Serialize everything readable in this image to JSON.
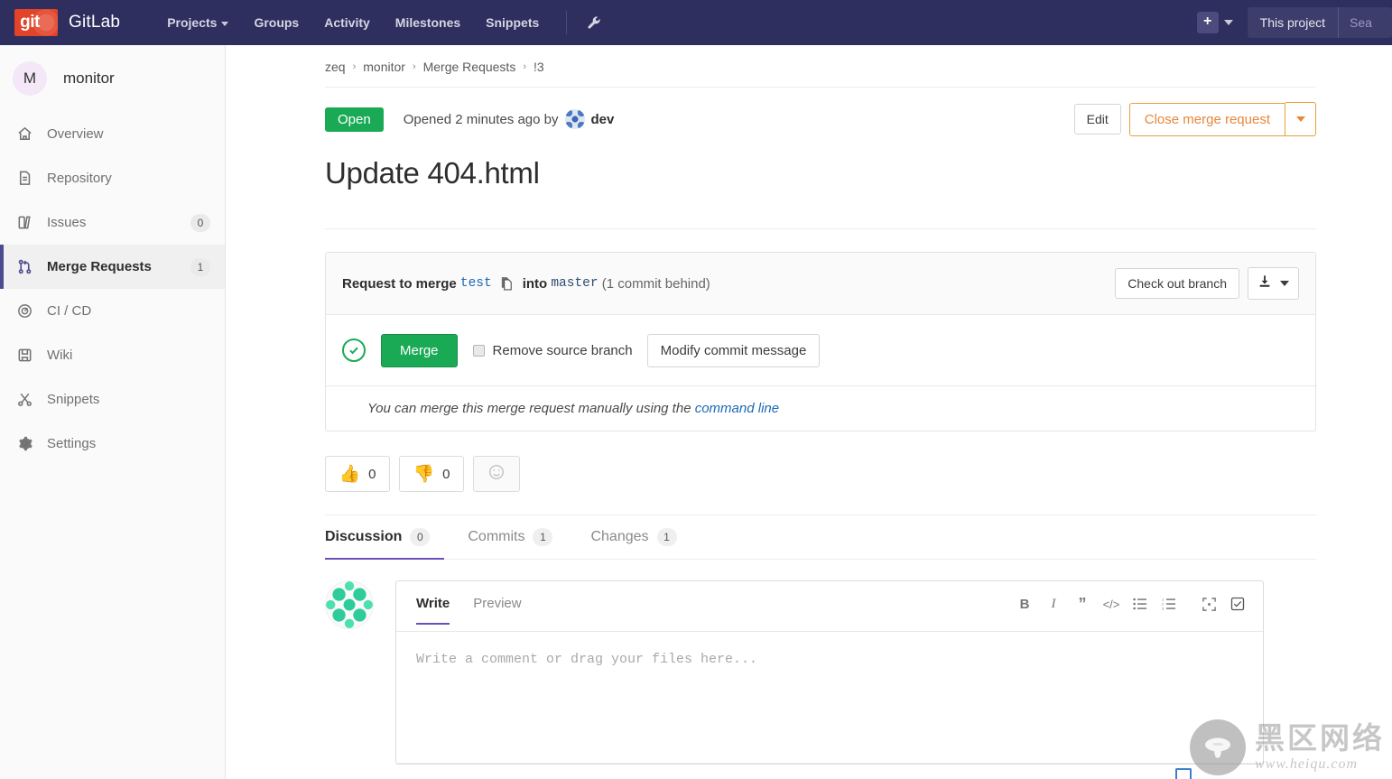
{
  "topnav": {
    "brand": "GitLab",
    "logo_text": "git",
    "links": [
      {
        "label": "Projects",
        "has_caret": true,
        "name": "nav-projects"
      },
      {
        "label": "Groups",
        "has_caret": false,
        "name": "nav-groups"
      },
      {
        "label": "Activity",
        "has_caret": false,
        "name": "nav-activity"
      },
      {
        "label": "Milestones",
        "has_caret": false,
        "name": "nav-milestones"
      },
      {
        "label": "Snippets",
        "has_caret": false,
        "name": "nav-snippets"
      }
    ],
    "wrench_icon": "wrench-icon",
    "plus_icon": "plus-icon",
    "search_scope": "This project",
    "search_placeholder": "Sea",
    "search_value": ""
  },
  "sidebar": {
    "project_initial": "M",
    "project_name": "monitor",
    "items": [
      {
        "label": "Overview",
        "icon": "home-icon",
        "badge": "",
        "active": false
      },
      {
        "label": "Repository",
        "icon": "doc-icon",
        "badge": "",
        "active": false
      },
      {
        "label": "Issues",
        "icon": "issues-icon",
        "badge": "0",
        "active": false
      },
      {
        "label": "Merge Requests",
        "icon": "merge-icon",
        "badge": "1",
        "active": true
      },
      {
        "label": "CI / CD",
        "icon": "rocket-icon",
        "badge": "",
        "active": false
      },
      {
        "label": "Wiki",
        "icon": "book-icon",
        "badge": "",
        "active": false
      },
      {
        "label": "Snippets",
        "icon": "scissors-icon",
        "badge": "",
        "active": false
      },
      {
        "label": "Settings",
        "icon": "gear-icon",
        "badge": "",
        "active": false
      }
    ]
  },
  "breadcrumb": {
    "group": "zeq",
    "project": "monitor",
    "section": "Merge Requests",
    "id": "!3",
    "separator": "›"
  },
  "mr_header": {
    "state_badge": "Open",
    "opened_text": "Opened 2 minutes ago by",
    "author": "dev",
    "edit_label": "Edit",
    "close_label": "Close merge request",
    "title": "Update 404.html"
  },
  "merge_widget": {
    "request_prefix": "Request to merge",
    "source_branch": "test",
    "copy_icon": "copy-branch-icon",
    "into_label": "into",
    "target_branch": "master",
    "behind_note": "(1 commit behind)",
    "checkout_label": "Check out branch",
    "download_icon": "download-icon",
    "status_icon": "check-circle-icon",
    "merge_label": "Merge",
    "remove_branch_label": "Remove source branch",
    "remove_branch_checked": false,
    "modify_commit_label": "Modify commit message",
    "manual_text_before": "You can merge this merge request manually using the",
    "manual_link": "command line"
  },
  "awards": {
    "thumbsup_emoji": "👍",
    "thumbsup_count": "0",
    "thumbsdown_emoji": "👎",
    "thumbsdown_count": "0",
    "add_reaction_icon": "smiley-icon"
  },
  "tabs": [
    {
      "label": "Discussion",
      "count": "0",
      "active": true
    },
    {
      "label": "Commits",
      "count": "1",
      "active": false
    },
    {
      "label": "Changes",
      "count": "1",
      "active": false
    }
  ],
  "comment_form": {
    "avatar": "user-identicon-avatar",
    "write_tab": "Write",
    "preview_tab": "Preview",
    "placeholder": "Write a comment or drag your files here...",
    "value": "",
    "toolbar": [
      {
        "name": "bold-icon",
        "glyph": "B"
      },
      {
        "name": "italic-icon",
        "glyph": "I"
      },
      {
        "name": "quote-icon",
        "glyph": "”"
      },
      {
        "name": "code-icon",
        "glyph": "</>"
      },
      {
        "name": "bullet-list-icon",
        "glyph": "☰"
      },
      {
        "name": "numbered-list-icon",
        "glyph": "1≡"
      },
      {
        "name": "task-list-icon",
        "glyph": "☑"
      },
      {
        "name": "fullscreen-icon",
        "glyph": "⛶"
      }
    ]
  },
  "watermark": {
    "logo": "mushroom-logo",
    "title": "黑区网络",
    "url": "www.heiqu.com"
  },
  "colors": {
    "nav_bg": "#2e2e5f",
    "accent_purple": "#6b4fbb",
    "green": "#1aaa55",
    "orange": "#e8873b",
    "link_blue": "#1b69b6",
    "logo_orange": "#e24329"
  }
}
